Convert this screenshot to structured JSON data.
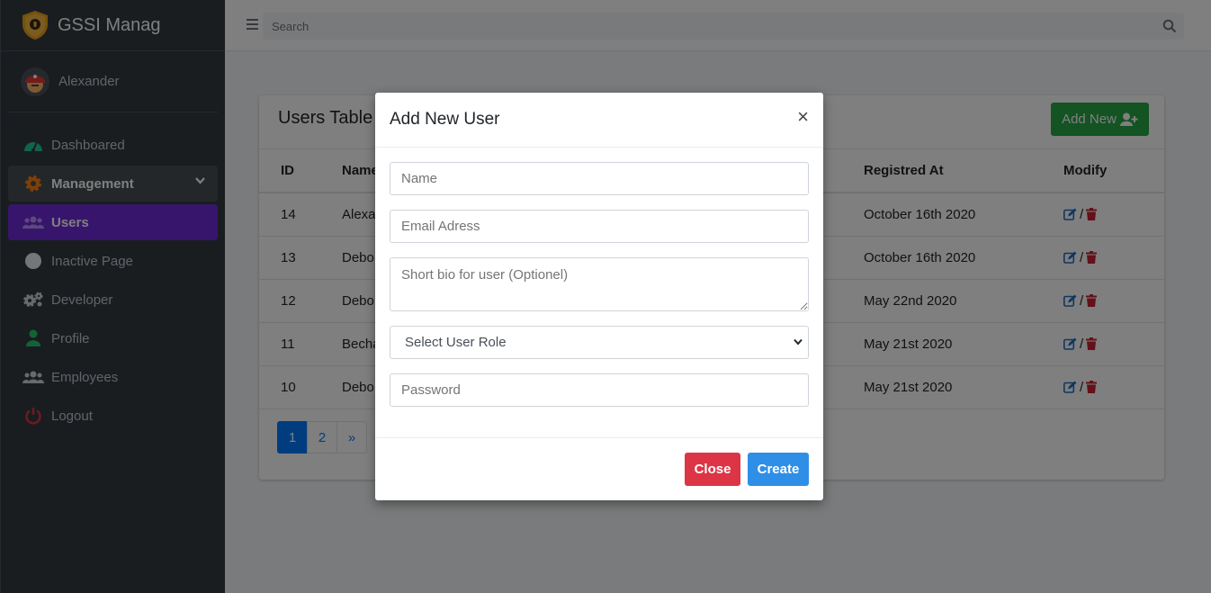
{
  "brand": {
    "name": "GSSI Manag"
  },
  "user": {
    "name": "Alexander"
  },
  "sidebar": {
    "items": [
      {
        "label": "Dashboared"
      },
      {
        "label": "Management"
      },
      {
        "label": "Users"
      },
      {
        "label": "Inactive Page"
      },
      {
        "label": "Developer"
      },
      {
        "label": "Profile"
      },
      {
        "label": "Employees"
      },
      {
        "label": "Logout"
      }
    ]
  },
  "topbar": {
    "search_placeholder": "Search"
  },
  "card": {
    "title": "Users Table",
    "add_button": "Add New",
    "columns": [
      "ID",
      "Name",
      "Registred At",
      "Modify"
    ],
    "rows": [
      {
        "id": "14",
        "name": "Alexa",
        "registered": "October 16th 2020"
      },
      {
        "id": "13",
        "name": "Debo",
        "registered": "October 16th 2020"
      },
      {
        "id": "12",
        "name": "Debo",
        "registered": "May 22nd 2020"
      },
      {
        "id": "11",
        "name": "Becha",
        "registered": "May 21st 2020"
      },
      {
        "id": "10",
        "name": "Debo",
        "registered": "May 21st 2020"
      }
    ],
    "modify_separator": "/",
    "pagination": [
      "1",
      "2",
      "»"
    ]
  },
  "modal": {
    "title": "Add New User",
    "close_x": "×",
    "name_placeholder": "Name",
    "email_placeholder": "Email Adress",
    "bio_placeholder": "Short bio for user (Optionel)",
    "role_selected": "Select User Role",
    "password_placeholder": "Password",
    "close_button": "Close",
    "create_button": "Create"
  },
  "colors": {
    "sidebar_bg": "#343a40",
    "active_item": "#6f2bd9",
    "success": "#28a745",
    "danger": "#dc3545",
    "primary": "#2f8fe6"
  }
}
